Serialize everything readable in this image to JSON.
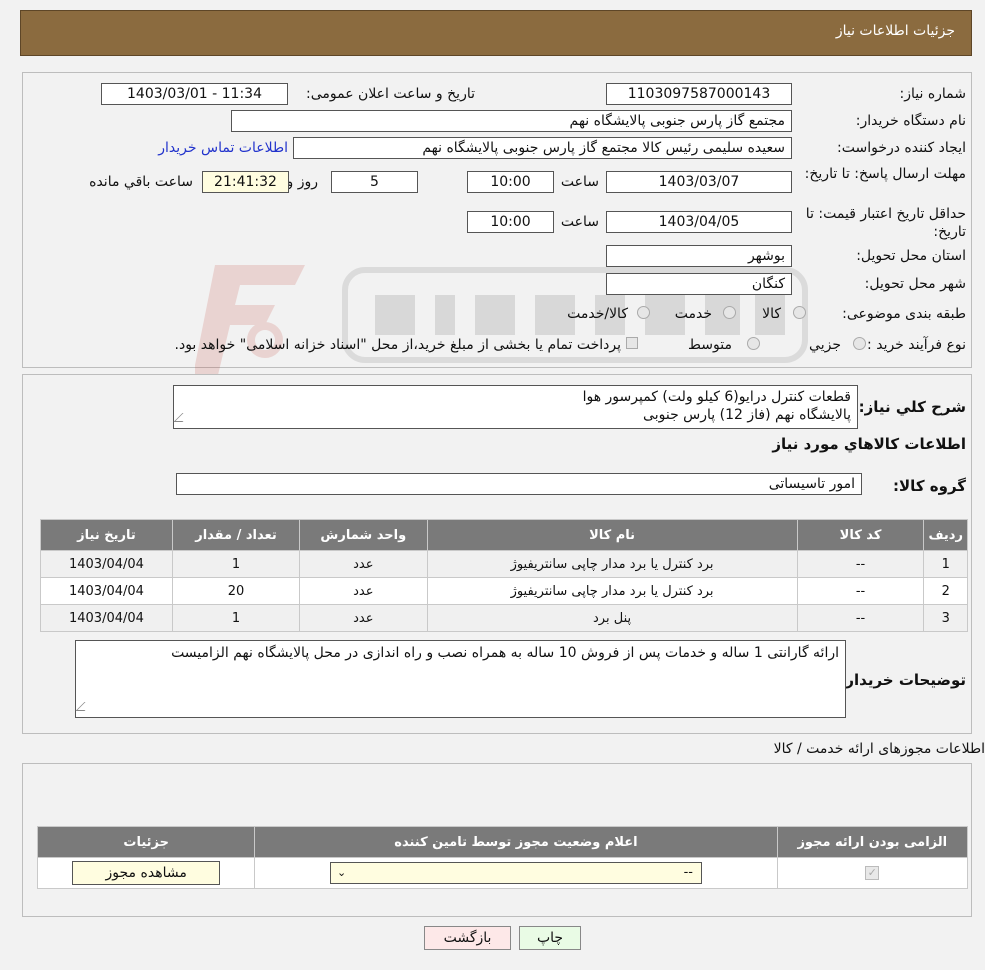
{
  "header": {
    "title": "جزئیات اطلاعات نیاز"
  },
  "info": {
    "need_number_label": "شماره نیاز:",
    "need_number": "1103097587000143",
    "announce_label": "تاریخ و ساعت اعلان عمومی:",
    "announce_value": "1403/03/01 - 11:34",
    "buyer_org_label": "نام دستگاه خریدار:",
    "buyer_org": "مجتمع گاز پارس جنوبی  پالایشگاه نهم",
    "creator_label": "ایجاد کننده درخواست:",
    "creator": "سعیده سلیمی رئیس کالا مجتمع گاز پارس جنوبی  پالایشگاه نهم",
    "contact_link": "اطلاعات تماس خریدار",
    "deadline_label": "مهلت ارسال پاسخ: تا تاریخ:",
    "deadline_date": "1403/03/07",
    "time_label": "ساعت",
    "deadline_time": "10:00",
    "days": "5",
    "days_label": "روز و",
    "remaining": "21:41:32",
    "remaining_label": "ساعت باقي مانده",
    "validity_label": "حداقل تاریخ اعتبار قیمت: تا تاریخ:",
    "validity_date": "1403/04/05",
    "validity_time": "10:00",
    "province_label": "استان محل تحویل:",
    "province": "بوشهر",
    "city_label": "شهر محل تحویل:",
    "city": "کنگان",
    "category_label": "طبقه بندی موضوعی:",
    "category_options": [
      "کالا",
      "خدمت",
      "کالا/خدمت"
    ],
    "process_label": "نوع فرآیند خرید :",
    "process_options": [
      "جزيي",
      "متوسط"
    ],
    "process_note": "پرداخت تمام یا بخشی از مبلغ خرید،از محل \"اسناد خزانه اسلامی\" خواهد بود."
  },
  "description": {
    "label": "شرح کلي نياز:",
    "line1": "قطعات کنترل درایو(6 کیلو ولت) کمپرسور هوا",
    "line2": "پالایشگاه نهم (فاز 12) پارس جنوبی",
    "goods_info_title": "اطلاعات کالاهاي مورد نياز",
    "goods_group_label": "گروه کالا:",
    "goods_group": "امور تاسیساتی"
  },
  "items_table": {
    "headers": [
      "رديف",
      "کد کالا",
      "نام کالا",
      "واحد شمارش",
      "تعداد / مقدار",
      "تاریخ نیاز"
    ],
    "rows": [
      [
        "1",
        "--",
        "برد کنترل یا برد مدار چاپی سانتریفیوژ",
        "عدد",
        "1",
        "1403/04/04"
      ],
      [
        "2",
        "--",
        "برد کنترل یا برد مدار چاپی سانتریفیوژ",
        "عدد",
        "20",
        "1403/04/04"
      ],
      [
        "3",
        "--",
        "پنل برد",
        "عدد",
        "1",
        "1403/04/04"
      ]
    ]
  },
  "buyer_notes": {
    "label": "توضیحات خریدار:",
    "text": "ارائه گارانتی 1 ساله و خدمات پس از فروش 10 ساله به همراه نصب و راه اندازی در محل پالایشگاه نهم الزامیست"
  },
  "permits": {
    "title": "اطلاعات مجوزهای ارائه خدمت / کالا",
    "headers": [
      "الزامی بودن ارائه مجوز",
      "اعلام وضعیت مجوز توسط تامین کننده",
      "جزئیات"
    ],
    "select_value": "--",
    "view_button": "مشاهده مجوز"
  },
  "footer": {
    "print_label": "چاپ",
    "back_label": "بازگشت"
  },
  "colors": {
    "header_bg": "#8b6b3f",
    "table_header_bg": "#7a7a7a",
    "link": "#2233cc"
  }
}
